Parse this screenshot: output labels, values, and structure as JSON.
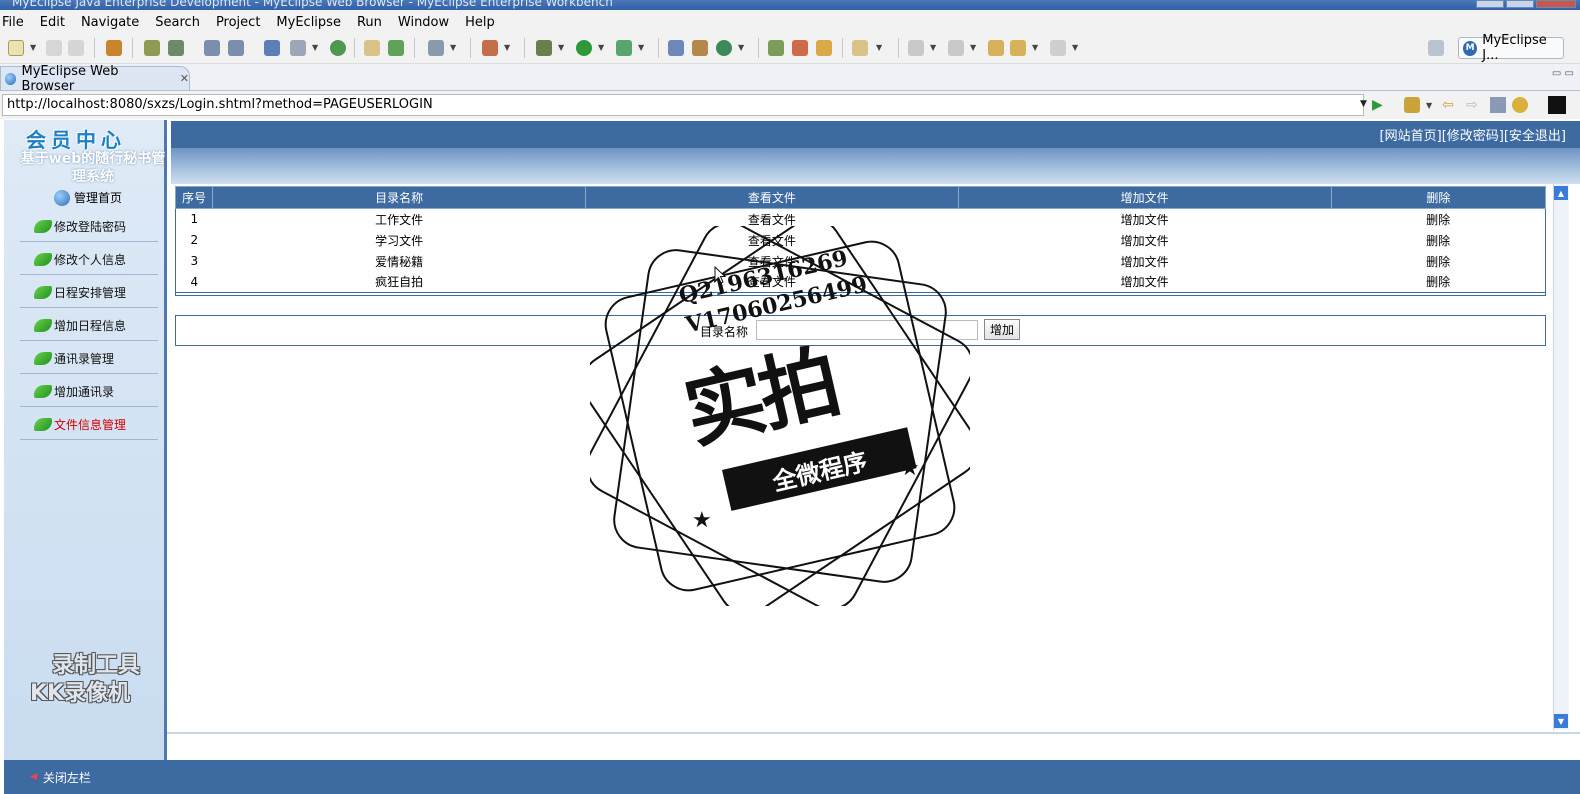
{
  "window": {
    "title": "MyEclipse Java Enterprise Development - MyEclipse Web Browser - MyEclipse Enterprise Workbench"
  },
  "menu": [
    "File",
    "Edit",
    "Navigate",
    "Search",
    "Project",
    "MyEclipse",
    "Run",
    "Window",
    "Help"
  ],
  "perspective": {
    "label": "MyEclipse J..."
  },
  "editor_tab": {
    "label": "MyEclipse Web Browser"
  },
  "address": {
    "url": "http://localhost:8080/sxzs/Login.shtml?method=PAGEUSERLOGIN"
  },
  "site": {
    "logo": "会员中心",
    "system_name": "基于web的随行秘书管理系统",
    "top_links": [
      "[网站首页]",
      "[修改密码]",
      "[安全退出]"
    ]
  },
  "sidebar": {
    "home": "管理首页",
    "items": [
      {
        "label": "修改登陆密码",
        "active": false
      },
      {
        "label": "修改个人信息",
        "active": false
      },
      {
        "label": "日程安排管理",
        "active": false
      },
      {
        "label": "增加日程信息",
        "active": false
      },
      {
        "label": "通讯录管理",
        "active": false
      },
      {
        "label": "增加通讯录",
        "active": false
      },
      {
        "label": "文件信息管理",
        "active": true
      }
    ],
    "close": "关闭左栏"
  },
  "table": {
    "headers": [
      "序号",
      "目录名称",
      "查看文件",
      "增加文件",
      "删除"
    ],
    "rows": [
      [
        "1",
        "工作文件",
        "查看文件",
        "增加文件",
        "删除"
      ],
      [
        "2",
        "学习文件",
        "查看文件",
        "增加文件",
        "删除"
      ],
      [
        "3",
        "爱情秘籍",
        "查看文件",
        "增加文件",
        "删除"
      ],
      [
        "4",
        "疯狂自拍",
        "查看文件",
        "增加文件",
        "删除"
      ]
    ]
  },
  "add_form": {
    "label": "目录名称",
    "input_value": "",
    "button": "增加"
  },
  "watermark": {
    "stamp_lines": [
      "Q2196316269",
      "V17060256499"
    ],
    "stamp_big": "实拍",
    "stamp_ribbon": "全微程序",
    "recorder_line1": "录制工具",
    "recorder_line2": "KK录像机"
  },
  "colors": {
    "header_blue": "#3d6aa0",
    "active_nav": "#d40000"
  }
}
